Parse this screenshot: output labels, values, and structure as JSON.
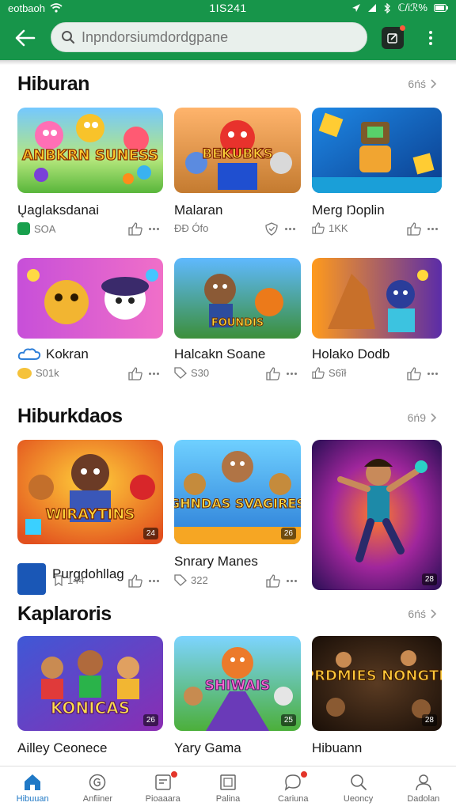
{
  "status": {
    "carrier": "eotbaoh",
    "time": "1IS241",
    "battery": "ℂ/iℛ%"
  },
  "search": {
    "placeholder": "Inpndorsiumdordgpane"
  },
  "sections": [
    {
      "title": "Hiburan",
      "more": "6ńś",
      "cards": [
        {
          "name": "Ųaglaksdanai",
          "meta": "SOA"
        },
        {
          "name": "Malaran",
          "meta": "ÐÐ Ófo"
        },
        {
          "name": "Merg Ŋoplin",
          "meta": "1KK"
        },
        {
          "name": "Kokran",
          "meta": "S01k"
        },
        {
          "name": "Halcakn Soane",
          "meta": "S30"
        },
        {
          "name": "Holako Dodb",
          "meta": "S6ĩł"
        }
      ]
    },
    {
      "title": "Hiburkdaos",
      "more": "6ń9",
      "cards": [
        {
          "name": "Purgdohllag",
          "meta": "144",
          "badge": "24"
        },
        {
          "name": "Snrary Manes",
          "meta": "322",
          "badge": "26"
        },
        {
          "name": "",
          "meta": "",
          "badge": "28"
        }
      ]
    },
    {
      "title": "Kaplaroris",
      "more": "6ńś",
      "cards": [
        {
          "name": "Ailley Ceonece",
          "meta": "",
          "badge": "26"
        },
        {
          "name": "Yary Gama",
          "meta": "",
          "badge": "25"
        },
        {
          "name": "Hibuann",
          "meta": "",
          "badge": "28"
        }
      ]
    }
  ],
  "thumb_text": [
    "ANBKRN SUNESS",
    "BEKUBKS",
    "WIRAYTINS",
    "GHNDAS SVAGIRES",
    "KONICAS",
    "SHIWAIS",
    "PRDMIES NONGTK"
  ],
  "bottom_nav": [
    {
      "label": "Hibuuan",
      "icon": "home-icon",
      "active": true
    },
    {
      "label": "Anfiiner",
      "icon": "circle-g-icon"
    },
    {
      "label": "Pioaaara",
      "icon": "inbox-icon",
      "dot": true
    },
    {
      "label": "Palina",
      "icon": "frame-icon"
    },
    {
      "label": "Cariuna",
      "icon": "chat-icon",
      "dot": true
    },
    {
      "label": "Ueoncy",
      "icon": "search-icon"
    },
    {
      "label": "Dadolan",
      "icon": "profile-icon"
    }
  ],
  "colors": {
    "brand": "#17954a",
    "active": "#2079c6"
  }
}
